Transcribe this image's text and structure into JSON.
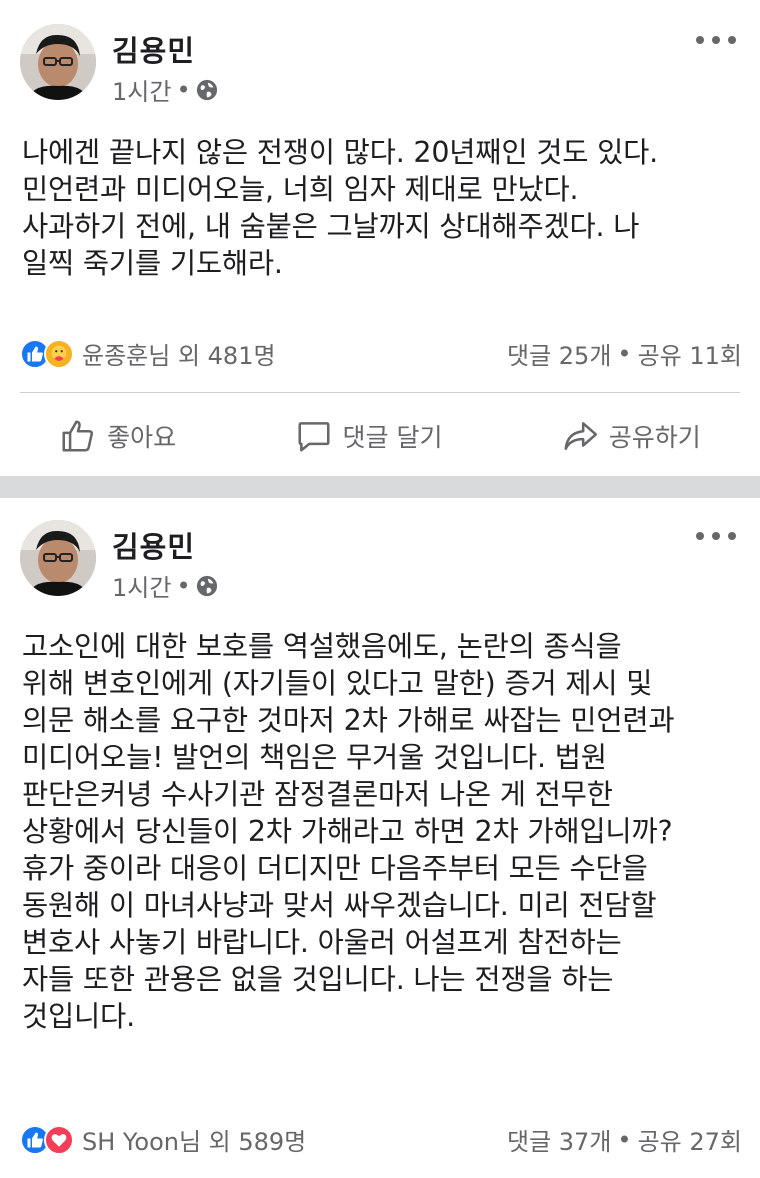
{
  "posts": [
    {
      "author": "김용민",
      "time": "1시간",
      "meta_dot": "•",
      "privacy_icon": "globe-icon",
      "body": "나에겐 끝나지 않은 전쟁이 많다. 20년째인 것도 있다.\n민언련과 미디어오늘, 너희 임자 제대로 만났다.\n사과하기 전에, 내 숨붙은 그날까지 상대해주겠다. 나\n일찍 죽기를 기도해라.",
      "reactions_text": "윤종훈님 외 481명",
      "reaction_icons": [
        "like-icon",
        "care-icon"
      ],
      "comments": "댓글 25개",
      "shares": "공유 11회",
      "actions": {
        "like": "좋아요",
        "comment": "댓글 달기",
        "share": "공유하기"
      }
    },
    {
      "author": "김용민",
      "time": "1시간",
      "meta_dot": "•",
      "privacy_icon": "globe-icon",
      "body": "고소인에 대한 보호를 역설했음에도, 논란의 종식을\n위해 변호인에게 (자기들이 있다고 말한) 증거 제시 및\n의문 해소를 요구한 것마저 2차 가해로 싸잡는 민언련과\n미디어오늘! 발언의 책임은 무거울 것입니다. 법원\n판단은커녕 수사기관 잠정결론마저 나온 게 전무한\n상황에서 당신들이 2차 가해라고 하면 2차 가해입니까?\n휴가 중이라 대응이 더디지만 다음주부터 모든 수단을\n동원해 이 마녀사냥과 맞서 싸우겠습니다. 미리 전담할\n변호사 사놓기 바랍니다. 아울러 어설프게 참전하는\n자들 또한 관용은 없을 것입니다. 나는 전쟁을 하는\n것입니다.",
      "reactions_text": "SH Yoon님 외 589명",
      "reaction_icons": [
        "like-icon",
        "love-icon"
      ],
      "comments": "댓글 37개",
      "shares": "공유 27회"
    }
  ],
  "colors": {
    "text": "#1c1e21",
    "secondary": "#65676b",
    "like_blue": "#1877f2",
    "love_red": "#f33e58",
    "care_yellow": "#f7b125",
    "divider": "#d9dadc"
  }
}
